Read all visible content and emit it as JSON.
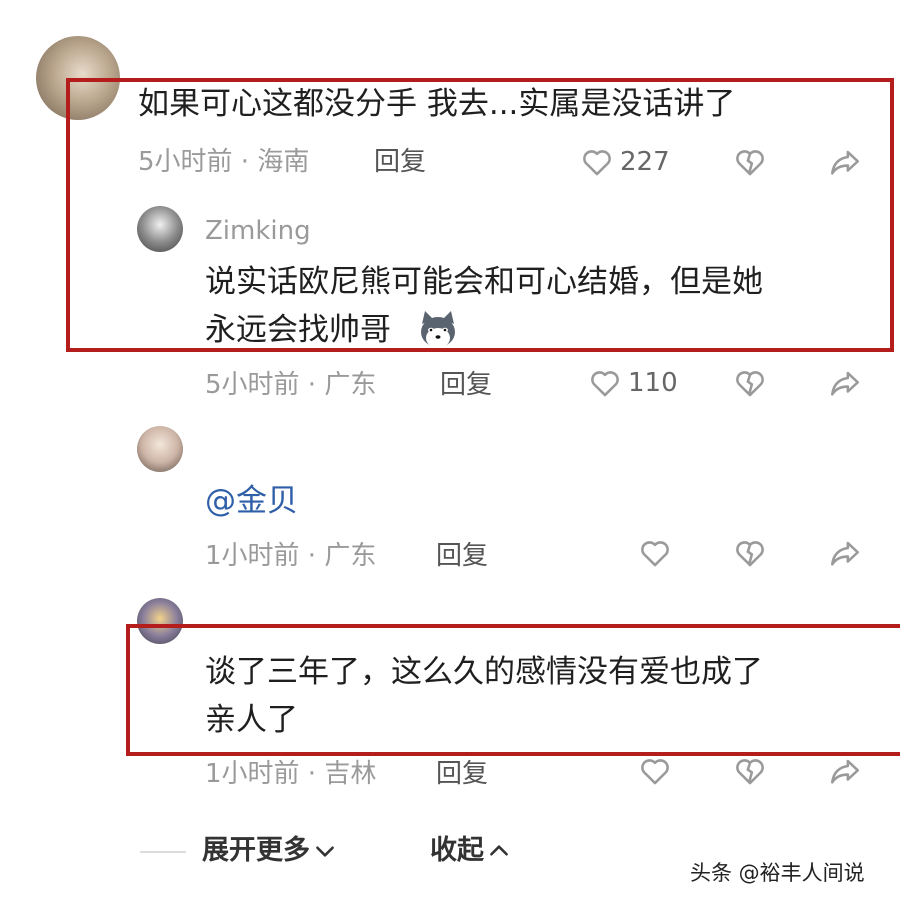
{
  "comments": [
    {
      "text": "如果可心这都没分手 我去...实属是没话讲了",
      "time_location": "5小时前 · 海南",
      "reply_label": "回复",
      "likes": "227"
    },
    {
      "username": "Zimking",
      "text_line1": "说实话欧尼熊可能会和可心结婚，但是她",
      "text_line2": "永远会找帅哥",
      "emoji": "husky-emoji",
      "time_location": "5小时前 · 广东",
      "reply_label": "回复",
      "likes": "110"
    },
    {
      "mention": "@金贝",
      "time_location": "1小时前 · 广东",
      "reply_label": "回复"
    },
    {
      "text_line1": "谈了三年了，这么久的感情没有爱也成了",
      "text_line2": "亲人了",
      "time_location": "1小时前 · 吉林",
      "reply_label": "回复"
    }
  ],
  "footer": {
    "expand_label": "展开更多",
    "collapse_label": "收起"
  },
  "watermark": "头条 @裕丰人间说",
  "icons": {
    "like": "heart-outline-icon",
    "dislike": "broken-heart-icon",
    "share": "share-arrow-icon"
  },
  "colors": {
    "highlight_box": "#b51c1c",
    "mention": "#2f5fa8"
  }
}
